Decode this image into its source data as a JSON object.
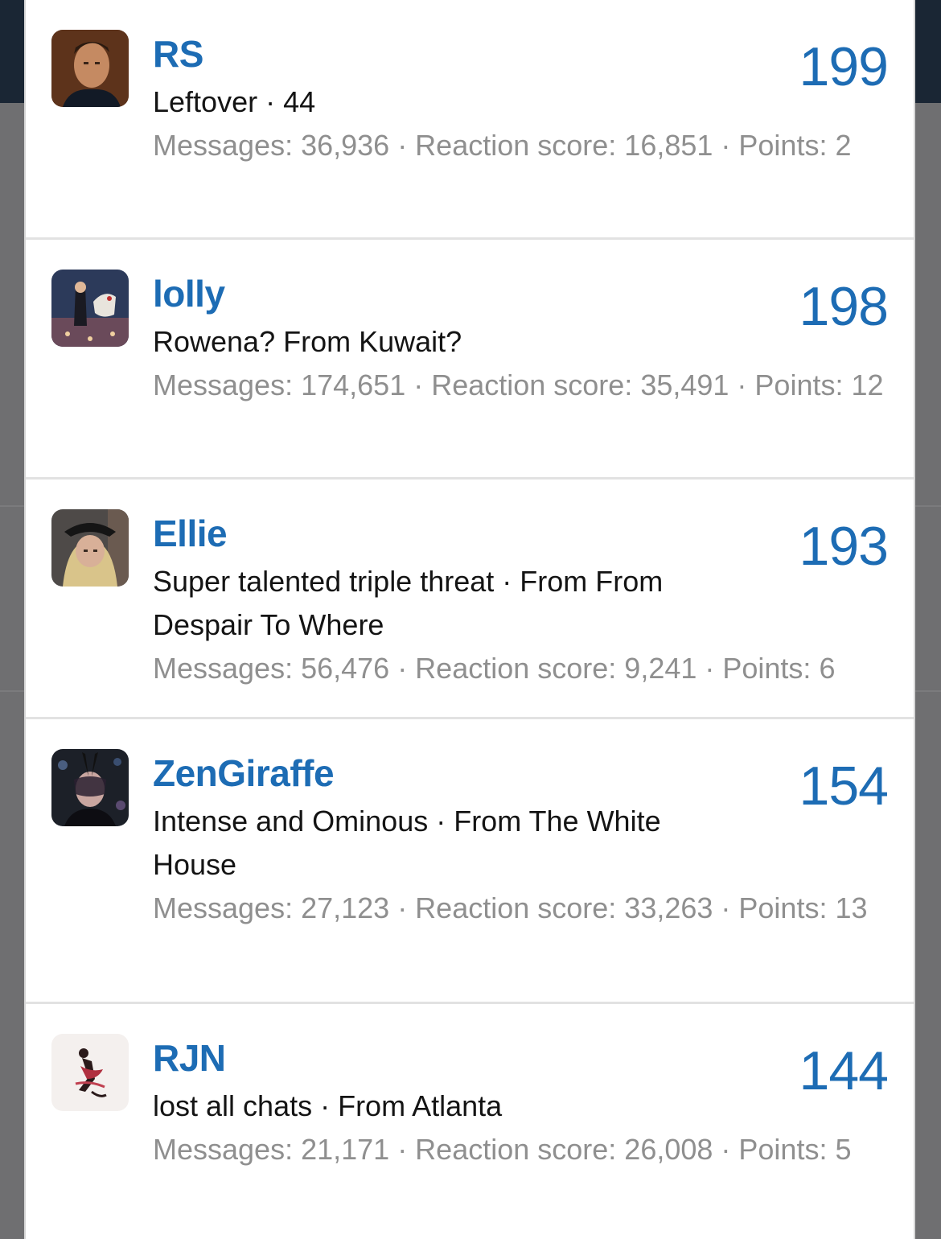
{
  "members": [
    {
      "username": "RS",
      "title": "Leftover · 44",
      "stats": "Messages: 36,936 · Reaction score: 16,851 · Points: 2",
      "score": "199",
      "avatar": "man-portrait-avatar"
    },
    {
      "username": "lolly",
      "title": "Rowena? From Kuwait?",
      "stats": "Messages: 174,651 · Reaction score: 35,491 · Points: 12",
      "score": "198",
      "avatar": "carousel-horse-avatar"
    },
    {
      "username": "Ellie",
      "title": "Super talented triple threat · From From Despair To Where",
      "stats": "Messages: 56,476 · Reaction score: 9,241 · Points: 6",
      "score": "193",
      "avatar": "blonde-woman-hat-avatar"
    },
    {
      "username": "ZenGiraffe",
      "title": "Intense and Ominous · From The White House",
      "stats": "Messages: 27,123 · Reaction score: 33,263 · Points: 13",
      "score": "154",
      "avatar": "masked-woman-avatar"
    },
    {
      "username": "RJN",
      "title": "lost all chats · From Atlanta",
      "stats": "Messages: 21,171 · Reaction score: 26,008 · Points: 5",
      "score": "144",
      "avatar": "dancer-illustration-avatar"
    }
  ],
  "colors": {
    "link_blue": "#1d6cb4",
    "muted_text": "#8f8f8f",
    "body_text": "#141414",
    "backdrop": "#6f6f71",
    "header_dark": "#1a2634"
  }
}
